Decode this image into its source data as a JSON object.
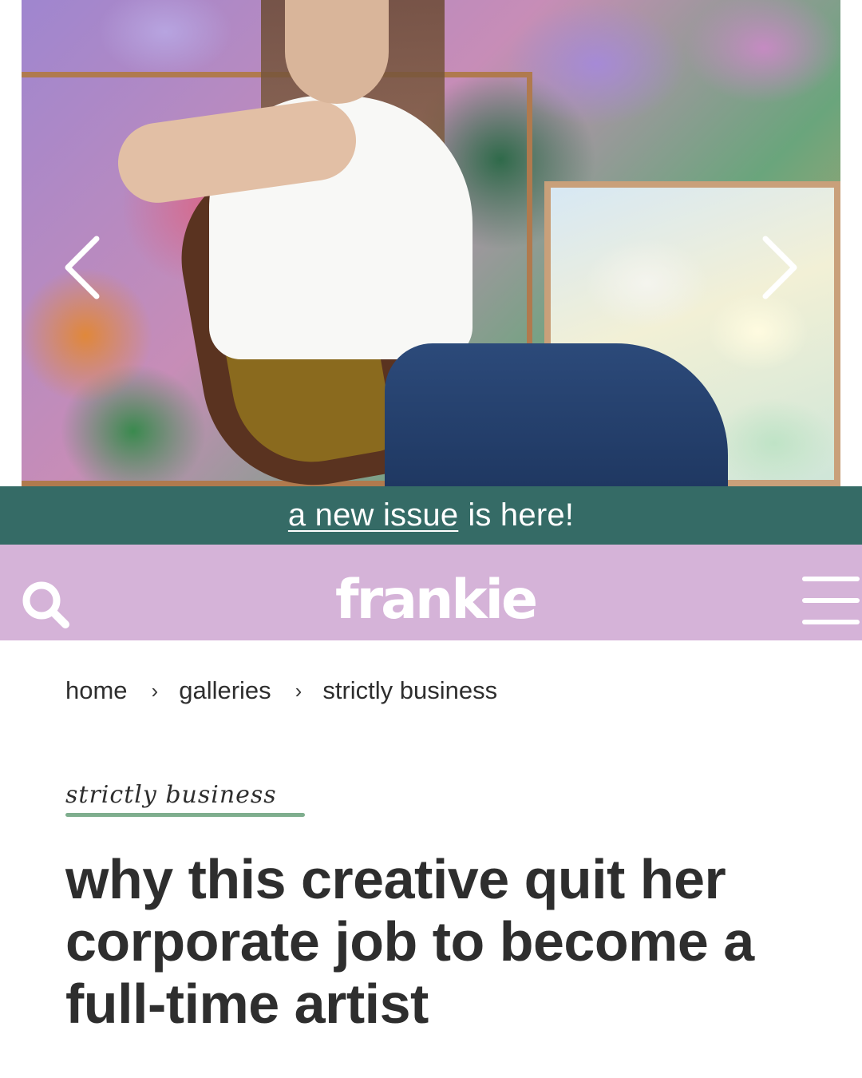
{
  "hero": {
    "prev_icon": "chevron-left-icon",
    "next_icon": "chevron-right-icon"
  },
  "announcement": {
    "link_text": "a new issue",
    "rest_text": "is here!",
    "background": "#356b66"
  },
  "header": {
    "logo_text": "frankie",
    "search_icon": "search-icon",
    "menu_icon": "hamburger-menu-icon",
    "background": "#d5b3d8"
  },
  "breadcrumb": {
    "items": [
      "home",
      "galleries",
      "strictly business"
    ],
    "separator": "›"
  },
  "article": {
    "category": "strictly business",
    "category_accent": "#7fae8e",
    "title": "why this creative quit her corporate job to become a full-time artist"
  }
}
